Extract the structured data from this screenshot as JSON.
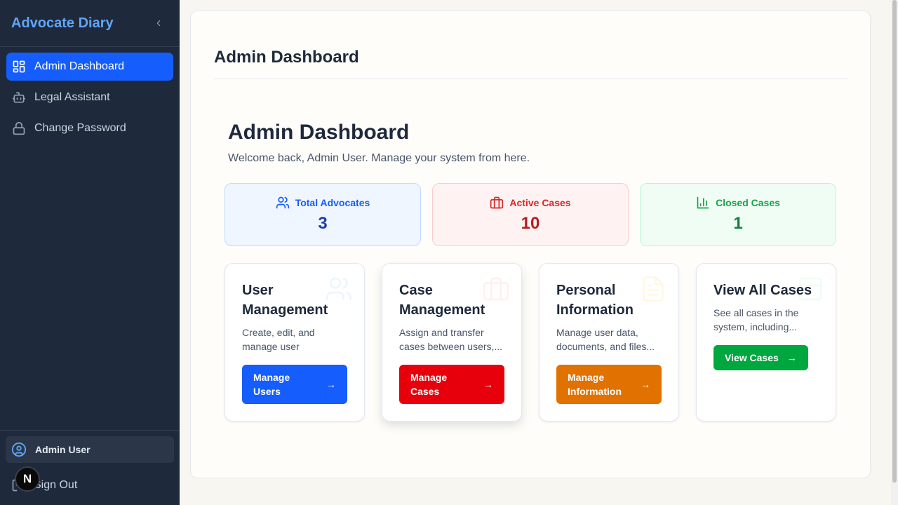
{
  "app": {
    "brand": "Advocate Diary"
  },
  "sidebar": {
    "items": [
      {
        "label": "Admin Dashboard",
        "icon": "dashboard-icon",
        "active": true
      },
      {
        "label": "Legal Assistant",
        "icon": "bot-icon",
        "active": false
      },
      {
        "label": "Change Password",
        "icon": "lock-icon",
        "active": false
      }
    ],
    "user_name": "Admin User",
    "sign_out": "Sign Out",
    "dev_badge": "N"
  },
  "page": {
    "title": "Admin Dashboard",
    "heading": "Admin Dashboard",
    "welcome": "Welcome back, Admin User. Manage your system from here."
  },
  "stats": [
    {
      "label": "Total Advocates",
      "value": "3",
      "icon": "users-icon",
      "color": "#155dfc"
    },
    {
      "label": "Active Cases",
      "value": "10",
      "icon": "briefcase-icon",
      "color": "#dc2626"
    },
    {
      "label": "Closed Cases",
      "value": "1",
      "icon": "bar-chart-icon",
      "color": "#16a34a"
    }
  ],
  "cards": [
    {
      "title": "User Management",
      "desc": "Create, edit, and manage user accounts...",
      "button": "Manage Users",
      "arrow": "→",
      "color": "#155dfc",
      "icon": "users-icon"
    },
    {
      "title": "Case Management",
      "desc": "Assign and transfer cases between users,...",
      "button": "Manage Cases",
      "arrow": "→",
      "color": "#e7000b",
      "icon": "briefcase-icon"
    },
    {
      "title": "Personal Information",
      "desc": "Manage user data, documents, and files...",
      "button": "Manage Information",
      "arrow": "→",
      "color": "#e17100",
      "icon": "document-icon"
    },
    {
      "title": "View All Cases",
      "desc": "See all cases in the system, including...",
      "button": "View Cases",
      "arrow": "→",
      "color": "#00a63e",
      "icon": "archive-icon"
    }
  ]
}
